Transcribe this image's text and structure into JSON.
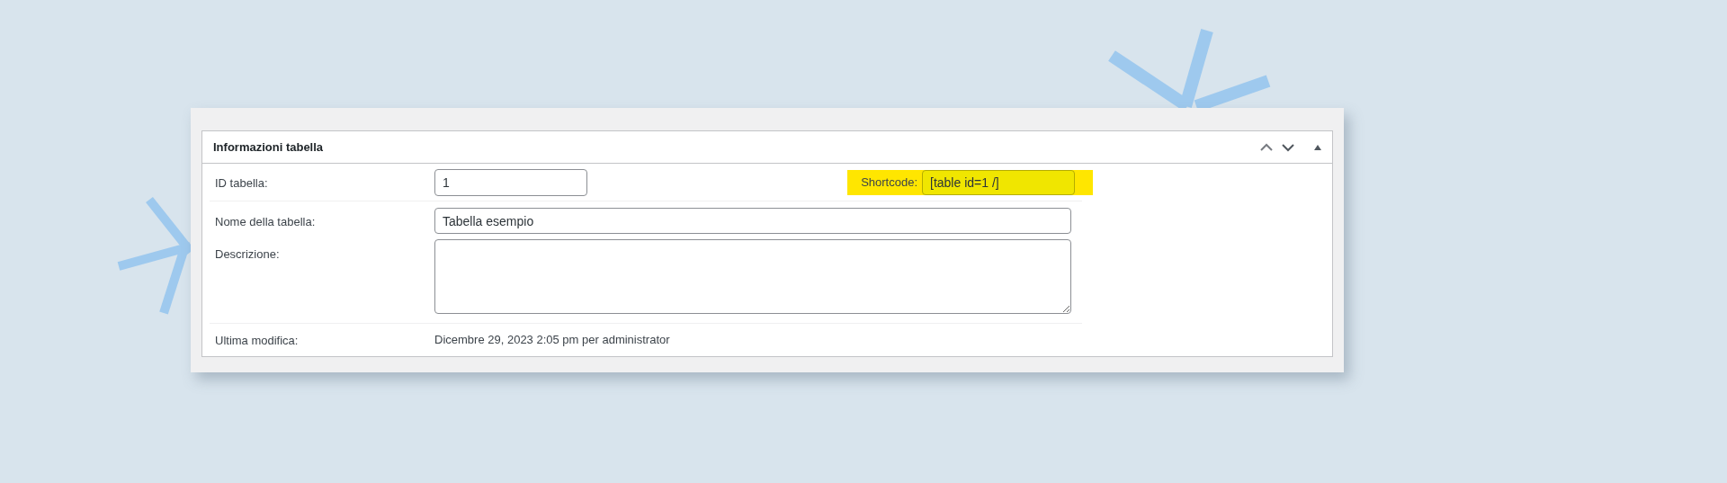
{
  "panel": {
    "title": "Informazioni tabella"
  },
  "rows": [
    {
      "kind": "id",
      "label": "ID tabella:",
      "value": "1",
      "shortcode": {
        "label": "Shortcode:",
        "value": "[table id=1 /]",
        "highlighted": true
      }
    },
    {
      "kind": "input",
      "label": "Nome della tabella:",
      "value": "Tabella esempio"
    },
    {
      "kind": "textarea",
      "label": "Descrizione:"
    },
    {
      "kind": "info",
      "label": "Ultima modifica:",
      "value": "Dicembre 29, 2023 2:05 pm per administrator"
    }
  ]
}
